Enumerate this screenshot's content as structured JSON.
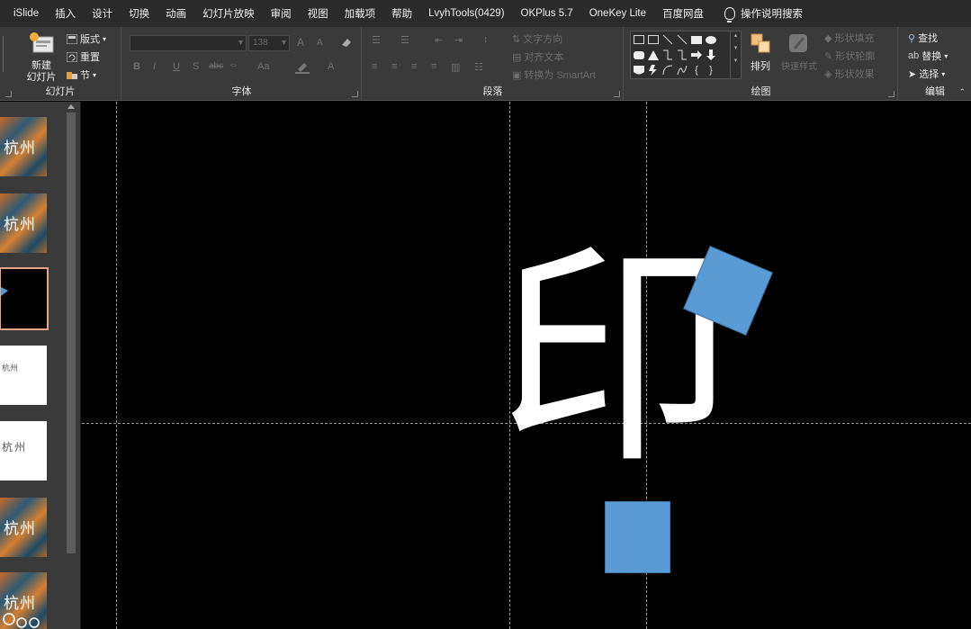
{
  "menubar": {
    "items": [
      "iSlide",
      "插入",
      "设计",
      "切换",
      "动画",
      "幻灯片放映",
      "审阅",
      "视图",
      "加载项",
      "帮助",
      "LvyhTools(0429)",
      "OKPlus 5.7",
      "OneKey Lite",
      "百度网盘"
    ],
    "search_label": "操作说明搜索"
  },
  "ribbon": {
    "slides": {
      "label": "幻灯片",
      "new_slide": "新建\n幻灯片",
      "layout": "版式",
      "reset": "重置",
      "section": "节"
    },
    "font": {
      "label": "字体",
      "size_value": "138",
      "btn_bold": "B",
      "btn_italic": "I",
      "btn_underline": "U",
      "btn_strike": "S",
      "btn_abc": "abc",
      "btn_aa": "Aa",
      "btn_grow": "A",
      "btn_shrink": "A"
    },
    "paragraph": {
      "label": "段落",
      "text_direction": "文字方向",
      "align_text": "对齐文本",
      "convert_smartart": "转换为 SmartArt"
    },
    "drawing": {
      "label": "绘图",
      "arrange": "排列",
      "quick_styles": "快速样式",
      "shape_fill": "形状填充",
      "shape_outline": "形状轮廓",
      "shape_effects": "形状效果"
    },
    "editing": {
      "label": "编辑",
      "find": "查找",
      "replace": "替换",
      "select": "选择"
    }
  },
  "thumbnails": [
    {
      "type": "photo",
      "text": "杭州"
    },
    {
      "type": "photo",
      "text": "杭州"
    },
    {
      "type": "selected",
      "text": ""
    },
    {
      "type": "white-small",
      "text": "杭州"
    },
    {
      "type": "white-mid",
      "text": "杭州"
    },
    {
      "type": "photo",
      "text": "杭州"
    },
    {
      "type": "photo",
      "text": "杭州"
    }
  ],
  "canvas": {
    "character": "印"
  },
  "colors": {
    "shape_fill": "#5b9bd5",
    "selection_border": "#e4a58c",
    "ribbon_bg": "#3a3a3a",
    "menubar_bg": "#2b2b2b"
  }
}
